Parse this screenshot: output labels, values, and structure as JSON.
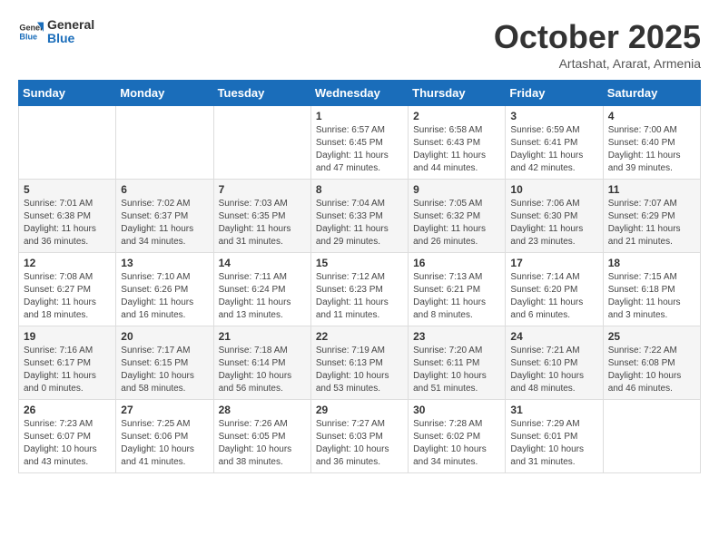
{
  "header": {
    "logo_line1": "General",
    "logo_line2": "Blue",
    "month_title": "October 2025",
    "subtitle": "Artashat, Ararat, Armenia"
  },
  "weekdays": [
    "Sunday",
    "Monday",
    "Tuesday",
    "Wednesday",
    "Thursday",
    "Friday",
    "Saturday"
  ],
  "weeks": [
    [
      {
        "day": "",
        "info": ""
      },
      {
        "day": "",
        "info": ""
      },
      {
        "day": "",
        "info": ""
      },
      {
        "day": "1",
        "info": "Sunrise: 6:57 AM\nSunset: 6:45 PM\nDaylight: 11 hours\nand 47 minutes."
      },
      {
        "day": "2",
        "info": "Sunrise: 6:58 AM\nSunset: 6:43 PM\nDaylight: 11 hours\nand 44 minutes."
      },
      {
        "day": "3",
        "info": "Sunrise: 6:59 AM\nSunset: 6:41 PM\nDaylight: 11 hours\nand 42 minutes."
      },
      {
        "day": "4",
        "info": "Sunrise: 7:00 AM\nSunset: 6:40 PM\nDaylight: 11 hours\nand 39 minutes."
      }
    ],
    [
      {
        "day": "5",
        "info": "Sunrise: 7:01 AM\nSunset: 6:38 PM\nDaylight: 11 hours\nand 36 minutes."
      },
      {
        "day": "6",
        "info": "Sunrise: 7:02 AM\nSunset: 6:37 PM\nDaylight: 11 hours\nand 34 minutes."
      },
      {
        "day": "7",
        "info": "Sunrise: 7:03 AM\nSunset: 6:35 PM\nDaylight: 11 hours\nand 31 minutes."
      },
      {
        "day": "8",
        "info": "Sunrise: 7:04 AM\nSunset: 6:33 PM\nDaylight: 11 hours\nand 29 minutes."
      },
      {
        "day": "9",
        "info": "Sunrise: 7:05 AM\nSunset: 6:32 PM\nDaylight: 11 hours\nand 26 minutes."
      },
      {
        "day": "10",
        "info": "Sunrise: 7:06 AM\nSunset: 6:30 PM\nDaylight: 11 hours\nand 23 minutes."
      },
      {
        "day": "11",
        "info": "Sunrise: 7:07 AM\nSunset: 6:29 PM\nDaylight: 11 hours\nand 21 minutes."
      }
    ],
    [
      {
        "day": "12",
        "info": "Sunrise: 7:08 AM\nSunset: 6:27 PM\nDaylight: 11 hours\nand 18 minutes."
      },
      {
        "day": "13",
        "info": "Sunrise: 7:10 AM\nSunset: 6:26 PM\nDaylight: 11 hours\nand 16 minutes."
      },
      {
        "day": "14",
        "info": "Sunrise: 7:11 AM\nSunset: 6:24 PM\nDaylight: 11 hours\nand 13 minutes."
      },
      {
        "day": "15",
        "info": "Sunrise: 7:12 AM\nSunset: 6:23 PM\nDaylight: 11 hours\nand 11 minutes."
      },
      {
        "day": "16",
        "info": "Sunrise: 7:13 AM\nSunset: 6:21 PM\nDaylight: 11 hours\nand 8 minutes."
      },
      {
        "day": "17",
        "info": "Sunrise: 7:14 AM\nSunset: 6:20 PM\nDaylight: 11 hours\nand 6 minutes."
      },
      {
        "day": "18",
        "info": "Sunrise: 7:15 AM\nSunset: 6:18 PM\nDaylight: 11 hours\nand 3 minutes."
      }
    ],
    [
      {
        "day": "19",
        "info": "Sunrise: 7:16 AM\nSunset: 6:17 PM\nDaylight: 11 hours\nand 0 minutes."
      },
      {
        "day": "20",
        "info": "Sunrise: 7:17 AM\nSunset: 6:15 PM\nDaylight: 10 hours\nand 58 minutes."
      },
      {
        "day": "21",
        "info": "Sunrise: 7:18 AM\nSunset: 6:14 PM\nDaylight: 10 hours\nand 56 minutes."
      },
      {
        "day": "22",
        "info": "Sunrise: 7:19 AM\nSunset: 6:13 PM\nDaylight: 10 hours\nand 53 minutes."
      },
      {
        "day": "23",
        "info": "Sunrise: 7:20 AM\nSunset: 6:11 PM\nDaylight: 10 hours\nand 51 minutes."
      },
      {
        "day": "24",
        "info": "Sunrise: 7:21 AM\nSunset: 6:10 PM\nDaylight: 10 hours\nand 48 minutes."
      },
      {
        "day": "25",
        "info": "Sunrise: 7:22 AM\nSunset: 6:08 PM\nDaylight: 10 hours\nand 46 minutes."
      }
    ],
    [
      {
        "day": "26",
        "info": "Sunrise: 7:23 AM\nSunset: 6:07 PM\nDaylight: 10 hours\nand 43 minutes."
      },
      {
        "day": "27",
        "info": "Sunrise: 7:25 AM\nSunset: 6:06 PM\nDaylight: 10 hours\nand 41 minutes."
      },
      {
        "day": "28",
        "info": "Sunrise: 7:26 AM\nSunset: 6:05 PM\nDaylight: 10 hours\nand 38 minutes."
      },
      {
        "day": "29",
        "info": "Sunrise: 7:27 AM\nSunset: 6:03 PM\nDaylight: 10 hours\nand 36 minutes."
      },
      {
        "day": "30",
        "info": "Sunrise: 7:28 AM\nSunset: 6:02 PM\nDaylight: 10 hours\nand 34 minutes."
      },
      {
        "day": "31",
        "info": "Sunrise: 7:29 AM\nSunset: 6:01 PM\nDaylight: 10 hours\nand 31 minutes."
      },
      {
        "day": "",
        "info": ""
      }
    ]
  ]
}
